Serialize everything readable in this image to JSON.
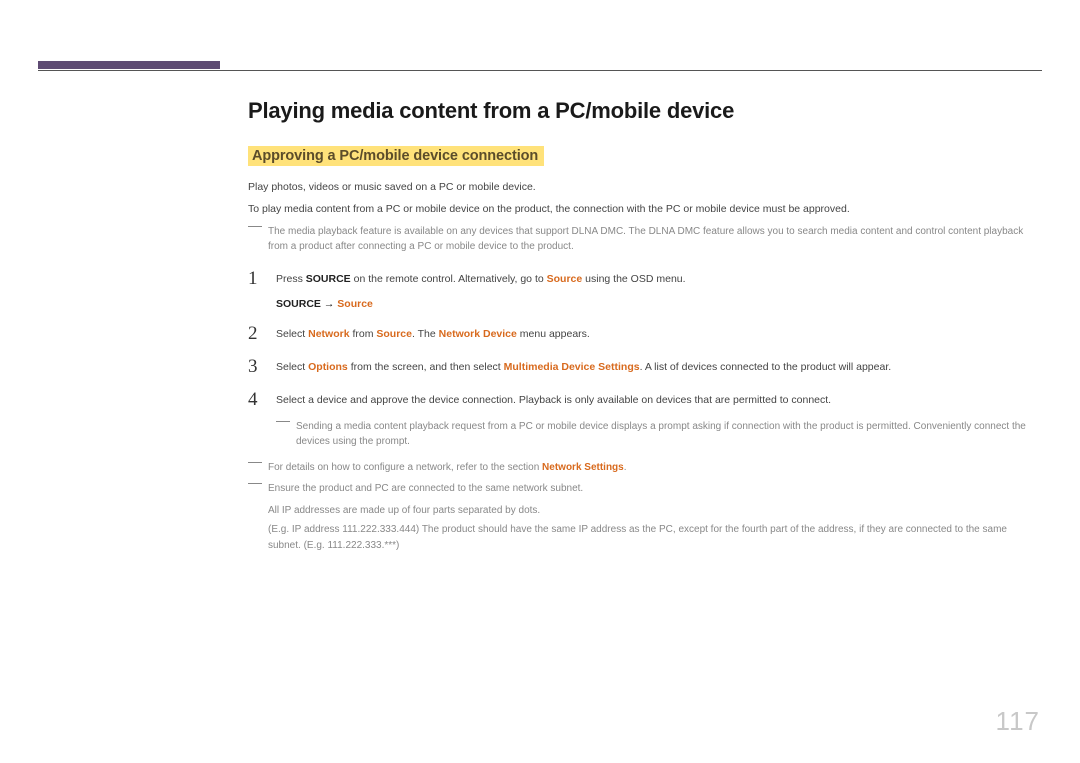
{
  "page_number": "117",
  "heading": "Playing media content from a PC/mobile device",
  "subheading": "Approving a PC/mobile device connection",
  "intro1": "Play photos, videos or music saved on a PC or mobile device.",
  "intro2": "To play media content from a PC or mobile device on the product, the connection with the PC or mobile device must be approved.",
  "topnote": "The media playback feature is available on any devices that support DLNA DMC. The DLNA DMC feature allows you to search media content and control content playback from a product after connecting a PC or mobile device to the product.",
  "step1": {
    "num": "1",
    "pre": "Press ",
    "b1": "SOURCE",
    "mid": " on the remote control. Alternatively, go to ",
    "o1": "Source",
    "post": " using the OSD menu.",
    "path_b": "SOURCE",
    "path_arrow": " → ",
    "path_o": "Source"
  },
  "step2": {
    "num": "2",
    "t1": "Select ",
    "o1": "Network",
    "t2": " from ",
    "o2": "Source",
    "t3": ". The ",
    "o3": "Network Device",
    "t4": " menu appears."
  },
  "step3": {
    "num": "3",
    "t1": "Select ",
    "o1": "Options",
    "t2": " from the screen, and then select ",
    "o2": "Multimedia Device Settings",
    "t3": ". A list of devices connected to the product will appear."
  },
  "step4": {
    "num": "4",
    "text": "Select a device and approve the device connection. Playback is only available on devices that are permitted to connect.",
    "note": "Sending a media content playback request from a PC or mobile device displays a prompt asking if connection with the product is permitted. Conveniently connect the devices using the prompt."
  },
  "trail1": {
    "pre": "For details on how to configure a network, refer to the section ",
    "o": "Network Settings",
    "post": "."
  },
  "trail2": {
    "line1": "Ensure the product and PC are connected to the same network subnet.",
    "line2": "All IP addresses are made up of four parts separated by dots.",
    "line3": "(E.g. IP address 111.222.333.444) The product should have the same IP address as the PC, except for the fourth part of the address, if they are connected to the same subnet. (E.g. 111.222.333.***)"
  }
}
